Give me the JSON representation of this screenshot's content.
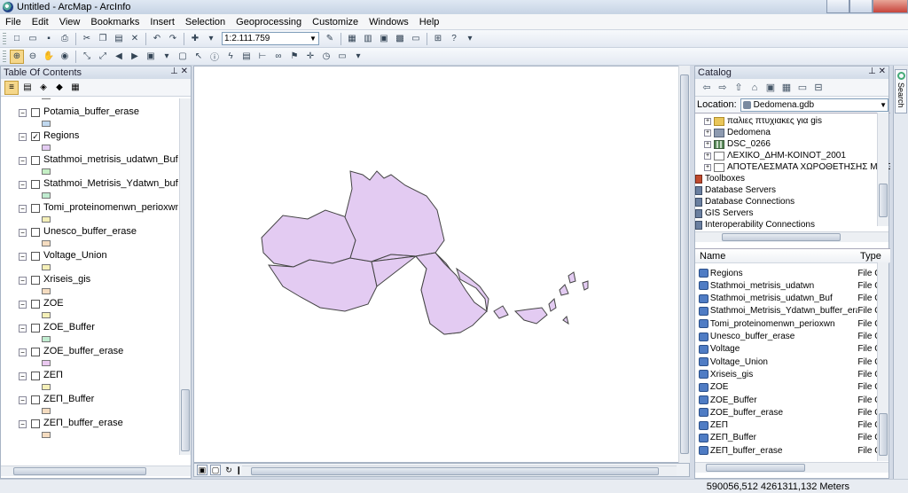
{
  "window": {
    "title": "Untitled - ArcMap - ArcInfo"
  },
  "menu": [
    "File",
    "Edit",
    "View",
    "Bookmarks",
    "Insert",
    "Selection",
    "Geoprocessing",
    "Customize",
    "Windows",
    "Help"
  ],
  "toolbar": {
    "scale": "1:2.111.759"
  },
  "toc": {
    "title": "Table Of Contents",
    "layers": [
      {
        "name": "",
        "checked": false,
        "swatch": "#c4efc4"
      },
      {
        "name": "Potamia_buffer_erase",
        "checked": false,
        "swatch": "#c0d8ef"
      },
      {
        "name": "Regions",
        "checked": true,
        "swatch": "#e3cbf2"
      },
      {
        "name": "Stathmoi_metrisis_udatwn_Buf",
        "checked": false,
        "swatch": "#c4efc4"
      },
      {
        "name": "Stathmoi_Metrisis_Ydatwn_buffer_eras",
        "checked": false,
        "swatch": "#c0ecd0"
      },
      {
        "name": "Tomi_proteinomenwn_perioxwn",
        "checked": false,
        "swatch": "#f5f0b8"
      },
      {
        "name": "Unesco_buffer_erase",
        "checked": false,
        "swatch": "#f5dcc0"
      },
      {
        "name": "Voltage_Union",
        "checked": false,
        "swatch": "#f5f0b8"
      },
      {
        "name": "Xriseis_gis",
        "checked": false,
        "swatch": "#f5dcc0"
      },
      {
        "name": "ZOE",
        "checked": false,
        "swatch": "#f5f0b8"
      },
      {
        "name": "ZOE_Buffer",
        "checked": false,
        "swatch": "#c0ecd0"
      },
      {
        "name": "ZOE_buffer_erase",
        "checked": false,
        "swatch": "#eac8f0"
      },
      {
        "name": "ΖΕΠ",
        "checked": false,
        "swatch": "#f5f0b8"
      },
      {
        "name": "ΖΕΠ_Buffer",
        "checked": false,
        "swatch": "#f5dcc0"
      },
      {
        "name": "ΖΕΠ_buffer_erase",
        "checked": false,
        "swatch": "#f5dcc0"
      }
    ]
  },
  "map": {
    "fill": "#e3cbf2",
    "stroke": "#444444"
  },
  "catalog": {
    "title": "Catalog",
    "location_label": "Location:",
    "location_value": "Dedomena.gdb",
    "tree": [
      {
        "name": "παλιες πτυχιακες για gis",
        "icon": "folder-icon",
        "kind": "folder"
      },
      {
        "name": "Dedomena",
        "icon": "geodatabase-icon",
        "kind": "gdb"
      },
      {
        "name": "DSC_0266",
        "icon": "raster-icon",
        "kind": "raster"
      },
      {
        "name": "ΛΕΧΙΚΟ_ΔΗΜ-ΚΟΙΝΟΤ_2001",
        "icon": "shapefile-icon",
        "kind": "shp"
      },
      {
        "name": "ΑΠΟΤΕΛΕΣΜΑΤΑ ΧΩΡΟΘΕΤΗΣΗΣ ΜΕ GIS",
        "icon": "shapefile-icon",
        "kind": "shp"
      }
    ],
    "roots": [
      "Toolboxes",
      "Database Servers",
      "Database Connections",
      "GIS Servers",
      "Interoperability Connections"
    ],
    "columns": {
      "name": "Name",
      "type": "Type"
    },
    "items": [
      {
        "name": "Regions",
        "type": "File G"
      },
      {
        "name": "Stathmoi_metrisis_udatwn",
        "type": "File G"
      },
      {
        "name": "Stathmoi_metrisis_udatwn_Buf",
        "type": "File G"
      },
      {
        "name": "Stathmoi_Metrisis_Ydatwn_buffer_erase",
        "type": "File G"
      },
      {
        "name": "Tomi_proteinomenwn_perioxwn",
        "type": "File G"
      },
      {
        "name": "Unesco_buffer_erase",
        "type": "File G"
      },
      {
        "name": "Voltage",
        "type": "File G"
      },
      {
        "name": "Voltage_Union",
        "type": "File G"
      },
      {
        "name": "Xriseis_gis",
        "type": "File G"
      },
      {
        "name": "ZOE",
        "type": "File G"
      },
      {
        "name": "ZOE_Buffer",
        "type": "File G"
      },
      {
        "name": "ZOE_buffer_erase",
        "type": "File G"
      },
      {
        "name": "ΖΕΠ",
        "type": "File G"
      },
      {
        "name": "ΖΕΠ_Buffer",
        "type": "File G"
      },
      {
        "name": "ΖΕΠ_buffer_erase",
        "type": "File G"
      }
    ]
  },
  "search_tab": {
    "label": "Search"
  },
  "status": {
    "coords": "590056,512  4261311,132 Meters"
  }
}
